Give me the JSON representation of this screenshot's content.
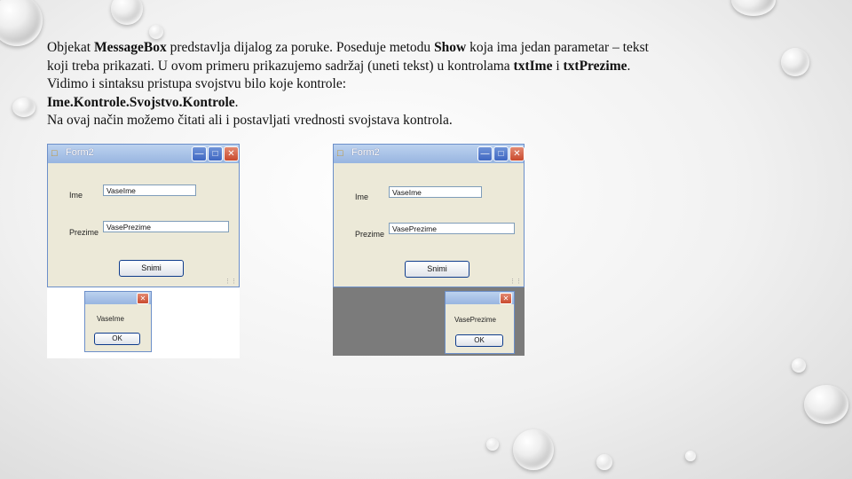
{
  "text": {
    "line1": {
      "a": "Objekat ",
      "b": "MessageBox",
      "c": " predstavlja dijalog za poruke. Poseduje metodu ",
      "d": "Show",
      "e": " koja ima jedan parametar – tekst"
    },
    "line2": {
      "a": "koji treba prikazati. U ovom primeru prikazujemo sadržaj (uneti tekst) u kontrolama ",
      "b": "txtIme",
      "c": " i ",
      "d": "txtPrezime",
      "e": "."
    },
    "line3": "Vidimo i sintaksu pristupa svojstvu bilo koje kontrole:",
    "line4": {
      "b": "Ime.Kontrole.Svojstvo.Kontrole",
      "e": "."
    },
    "line5": "Na ovaj način možemo čitati ali i postavljati vrednosti svojstava kontrola."
  },
  "screenshots": [
    {
      "form": {
        "title": "Form2",
        "label_ime": "Ime",
        "value_ime": "VaseIme",
        "label_prezime": "Prezime",
        "value_prezime": "VasePrezime",
        "button": "Snimi"
      },
      "msgbox": {
        "text": "VaseIme",
        "ok": "OK"
      }
    },
    {
      "form": {
        "title": "Form2",
        "label_ime": "Ime",
        "value_ime": "VaseIme",
        "label_prezime": "Prezime",
        "value_prezime": "VasePrezime",
        "button": "Snimi"
      },
      "msgbox": {
        "text": "VasePrezime",
        "ok": "OK"
      }
    }
  ],
  "icons": {
    "app": "form-app-icon",
    "minimize": "minimize-icon",
    "maximize": "maximize-icon",
    "close": "close-icon"
  },
  "colors": {
    "title_bar": "#98b5e0",
    "form_bg": "#ece9d8",
    "close_button": "#c94a2e"
  }
}
